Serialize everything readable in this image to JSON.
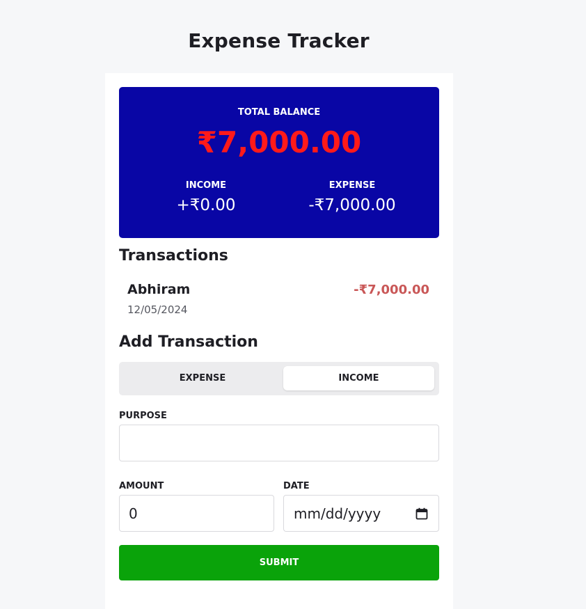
{
  "app": {
    "title": "Expense Tracker"
  },
  "balance": {
    "label": "TOTAL BALANCE",
    "amount": "₹7,000.00",
    "income_label": "INCOME",
    "income_value": "+₹0.00",
    "expense_label": "EXPENSE",
    "expense_value": "-₹7,000.00"
  },
  "transactions": {
    "title": "Transactions",
    "items": [
      {
        "name": "Abhiram",
        "date": "12/05/2024",
        "amount": "-₹7,000.00"
      }
    ]
  },
  "add_transaction": {
    "title": "Add Transaction",
    "toggle": {
      "expense_label": "EXPENSE",
      "income_label": "INCOME",
      "selected": "INCOME"
    },
    "purpose_label": "PURPOSE",
    "purpose_value": "",
    "amount_label": "AMOUNT",
    "amount_value": "0",
    "date_label": "DATE",
    "date_placeholder": "mm/dd/yyyy",
    "date_icon": "calendar-icon",
    "submit_label": "SUBMIT"
  },
  "colors": {
    "panel": "#0906a5",
    "balance_amount": "#ff1a1a",
    "negative_amount": "#c95757",
    "submit": "#0aa30a",
    "page_bg": "#f6f7f9"
  }
}
